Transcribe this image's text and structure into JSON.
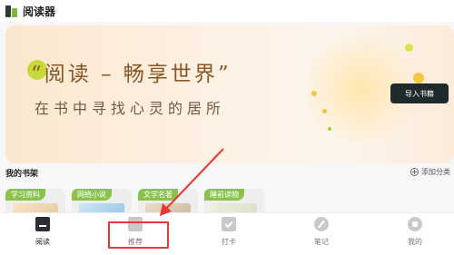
{
  "header": {
    "title": "阅读器",
    "logo_icon": "app-logo-icon"
  },
  "banner": {
    "headline": "“阅读 – 畅享世界”",
    "subtitle": "在书中寻找心灵的居所",
    "import_button": "导入书籍"
  },
  "shelf": {
    "title": "我的书架",
    "add_category": "添加分类",
    "categories": [
      {
        "label": "学习资料"
      },
      {
        "label": "网络小说"
      },
      {
        "label": "文学名著"
      },
      {
        "label": "睡前读物"
      }
    ]
  },
  "nav": {
    "items": [
      {
        "label": "阅读",
        "icon": "book-icon",
        "active": true
      },
      {
        "label": "推荐",
        "icon": "recommend-icon",
        "active": false
      },
      {
        "label": "打卡",
        "icon": "calendar-check-icon",
        "active": false
      },
      {
        "label": "笔记",
        "icon": "pen-icon",
        "active": false
      },
      {
        "label": "我的",
        "icon": "profile-icon",
        "active": false
      }
    ]
  },
  "colors": {
    "accent_green": "#8bc34a",
    "annotation_red": "#e53935",
    "button_dark": "#1e2a2c"
  }
}
